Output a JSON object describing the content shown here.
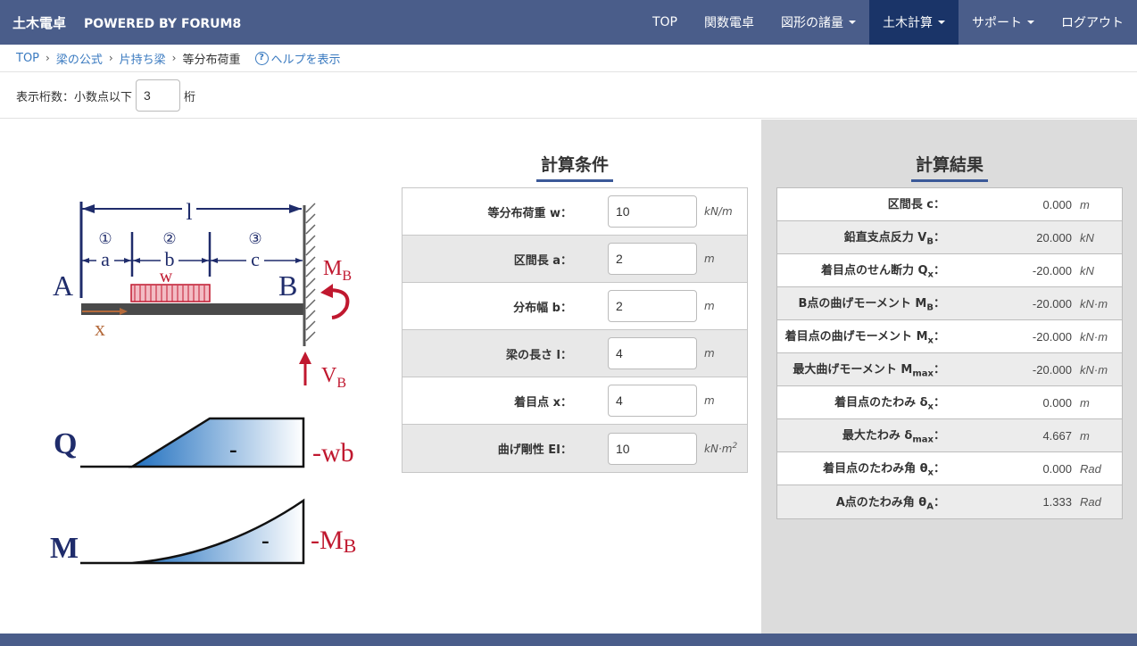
{
  "header": {
    "brand": "土木電卓",
    "powered": "POWERED BY FORUM8",
    "nav": [
      {
        "label": "TOP"
      },
      {
        "label": "関数電卓"
      },
      {
        "label": "図形の諸量"
      },
      {
        "label": "土木計算"
      },
      {
        "label": "サポート"
      },
      {
        "label": "ログアウト"
      }
    ]
  },
  "breadcrumb": {
    "items": [
      "TOP",
      "梁の公式",
      "片持ち梁"
    ],
    "current": "等分布荷重",
    "help": "ヘルプを表示",
    "help_icon": "?"
  },
  "digits": {
    "label": "表示桁数：小数点以下",
    "value": "3",
    "suffix": "桁"
  },
  "diagram": {
    "span": "l",
    "circle1": "①",
    "circle2": "②",
    "circle3": "③",
    "a": "a",
    "b": "b",
    "c": "c",
    "w": "w",
    "A": "A",
    "B": "B",
    "x": "x",
    "MB_main": "M",
    "MB_sub": "B",
    "VB_main": "V",
    "VB_sub": "B",
    "Q": "Q",
    "Q_sign": "-",
    "Q_end": "-wb",
    "M": "M",
    "M_sign": "-",
    "M_end_main": "-M",
    "M_end_sub": "B",
    "colors": {
      "navy": "#1f2c6b",
      "red": "#c0182f",
      "orange": "#b46a3b"
    }
  },
  "conditions": {
    "title": "計算条件",
    "rows": [
      {
        "label": "等分布荷重 w：",
        "value": "10",
        "unit": "kN/m"
      },
      {
        "label": "区間長 a：",
        "value": "2",
        "unit": "m"
      },
      {
        "label": "分布幅 b：",
        "value": "2",
        "unit": "m"
      },
      {
        "label": "梁の長さ l：",
        "value": "4",
        "unit": "m"
      },
      {
        "label": "着目点 x：",
        "value": "4",
        "unit": "m"
      },
      {
        "label": "曲げ剛性 EI：",
        "value": "10",
        "unit": "kN·m",
        "unit_sup": "2"
      }
    ]
  },
  "results": {
    "title": "計算結果",
    "rows": [
      {
        "label": "区間長 c",
        "sub": "",
        "colon": "：",
        "value": "0.000",
        "unit": "m"
      },
      {
        "label": "鉛直支点反力 V",
        "sub": "B",
        "colon": "：",
        "value": "20.000",
        "unit": "kN"
      },
      {
        "label": "着目点のせん断力 Q",
        "sub": "x",
        "colon": "：",
        "value": "-20.000",
        "unit": "kN"
      },
      {
        "label": "B点の曲げモーメント M",
        "sub": "B",
        "colon": "：",
        "value": "-20.000",
        "unit": "kN·m"
      },
      {
        "label": "着目点の曲げモーメント M",
        "sub": "x",
        "colon": "：",
        "value": "-20.000",
        "unit": "kN·m"
      },
      {
        "label": "最大曲げモーメント M",
        "sub": "max",
        "colon": "：",
        "value": "-20.000",
        "unit": "kN·m"
      },
      {
        "label": "着目点のたわみ δ",
        "sub": "x",
        "colon": "：",
        "value": "0.000",
        "unit": "m"
      },
      {
        "label": "最大たわみ δ",
        "sub": "max",
        "colon": "：",
        "value": "4.667",
        "unit": "m"
      },
      {
        "label": "着目点のたわみ角 θ",
        "sub": "x",
        "colon": "：",
        "value": "0.000",
        "unit": "Rad"
      },
      {
        "label": "A点のたわみ角 θ",
        "sub": "A",
        "colon": "：",
        "value": "1.333",
        "unit": "Rad"
      }
    ]
  }
}
